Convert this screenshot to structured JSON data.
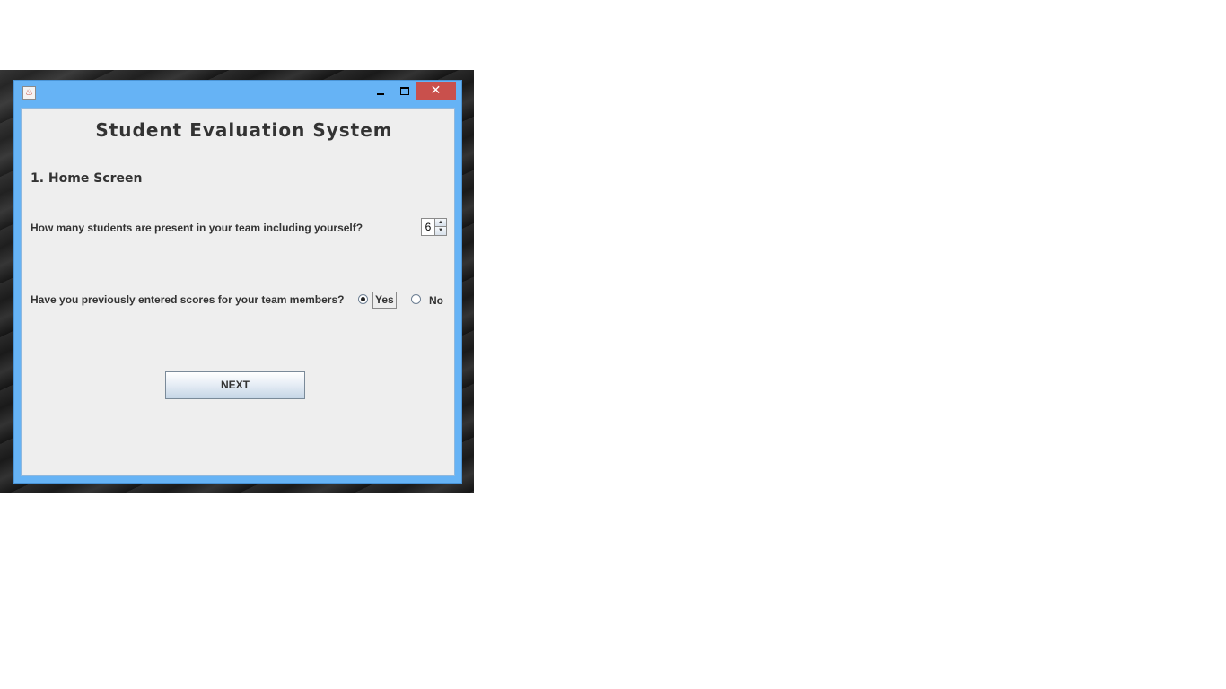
{
  "window": {
    "app_icon": "java-icon",
    "controls": {
      "minimize": "minimize-icon",
      "maximize": "maximize-icon",
      "close": "✕"
    }
  },
  "app": {
    "title": "Student Evaluation System",
    "section_heading": "1. Home Screen"
  },
  "form": {
    "students_question": "How many students are present in your team including yourself?",
    "students_count": "6",
    "scores_question": "Have you previously entered scores for your team members?",
    "options": [
      {
        "label": "Yes",
        "selected": true
      },
      {
        "label": "No",
        "selected": false
      }
    ],
    "next_label": "NEXT"
  },
  "colors": {
    "titlebar": "#66b3f5",
    "close_button": "#c9504c",
    "panel": "#eeeeee"
  }
}
